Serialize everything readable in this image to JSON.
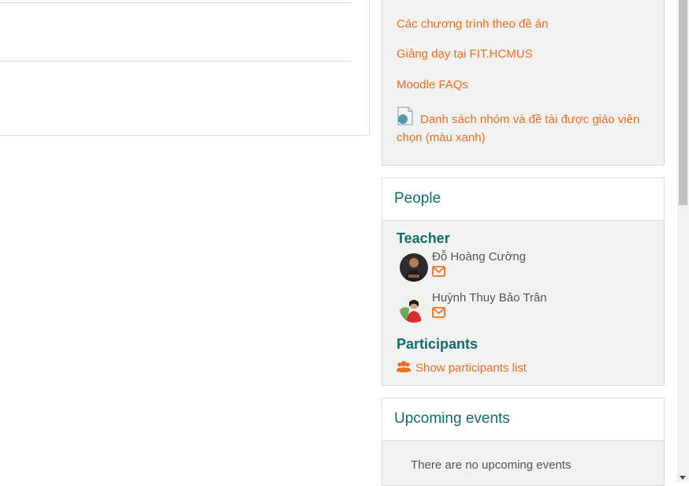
{
  "links": [
    "Các chương trình theo đề án",
    "Giảng dạy tại FIT.HCMUS",
    "Moodle FAQs"
  ],
  "resource": {
    "icon": "web-resource-icon",
    "label": "Danh sách nhóm và đề tài được giáo viên chọn (màu xanh)"
  },
  "people": {
    "title": "People",
    "teacher_heading": "Teacher",
    "teachers": [
      {
        "name": "Đỗ Hoàng Cường",
        "avatar": "avatar-dark-shirt"
      },
      {
        "name": "Huỳnh Thuy Bảo Trân",
        "avatar": "avatar-red-shirt"
      }
    ],
    "participants_heading": "Participants",
    "show_participants": "Show participants list"
  },
  "events": {
    "title": "Upcoming events",
    "empty_text": "There are no upcoming events"
  },
  "colors": {
    "link": "#f46d1b",
    "heading": "#0f6e6e",
    "block_bg": "#f2f2f2"
  }
}
